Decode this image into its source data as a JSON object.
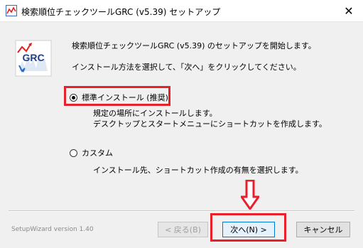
{
  "window": {
    "title": "検索順位チェックツールGRC (v5.39) セットアップ",
    "close_symbol": "✕"
  },
  "intro": {
    "line1": "検索順位チェックツールGRC (v5.39) のセットアップを開始します。",
    "line2": "インストール方法を選択して、「次へ」をクリックしてください。"
  },
  "options": [
    {
      "label": "標準インストール (推奨)",
      "selected": true,
      "description": [
        "規定の場所にインストールします。",
        "デスクトップとスタートメニューにショートカットを作成します。"
      ]
    },
    {
      "label": "カスタム",
      "selected": false,
      "description": [
        "インストール先、ショートカット作成の有無を選択します。"
      ]
    }
  ],
  "footer": {
    "version_label": "SetupWizard version 1.40",
    "back_label": "< 戻る(B)",
    "next_label": "次へ(N) >",
    "cancel_label": "キャンセル"
  },
  "colors": {
    "highlight": "#e8202a",
    "accent": "#0078d7"
  },
  "icons": {
    "app": "grc-app-icon",
    "logo": "grc-logo-icon",
    "close": "close-icon",
    "annotation": "down-arrow-icon"
  }
}
